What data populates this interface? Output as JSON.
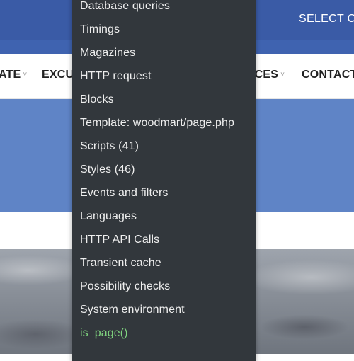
{
  "header": {
    "select_category": "SELECT CA"
  },
  "nav": {
    "items": [
      {
        "label": "ATE",
        "caret": "˅"
      },
      {
        "label": "EXCU"
      },
      {
        "label": "ICES",
        "caret": "˅"
      },
      {
        "label": "CONTACT"
      }
    ]
  },
  "debug_menu": {
    "items": [
      {
        "label": "Database queries"
      },
      {
        "label": "Timings"
      },
      {
        "label": "Magazines"
      },
      {
        "label": "HTTP request"
      },
      {
        "label": "Blocks"
      },
      {
        "label": "Template: woodmart/page.php"
      },
      {
        "label": "Scripts (41)"
      },
      {
        "label": "Styles (46)"
      },
      {
        "label": "Events and filters"
      },
      {
        "label": "Languages"
      },
      {
        "label": "HTTP API Calls"
      },
      {
        "label": "Transient cache"
      },
      {
        "label": "Possibility checks"
      },
      {
        "label": "System environment"
      },
      {
        "label": "is_page()"
      }
    ],
    "highlight_color": "#7fd37f"
  },
  "colors": {
    "topbar": "#3a5ba6",
    "hero": "#5f84c6",
    "menu_bg": "#32373c"
  }
}
